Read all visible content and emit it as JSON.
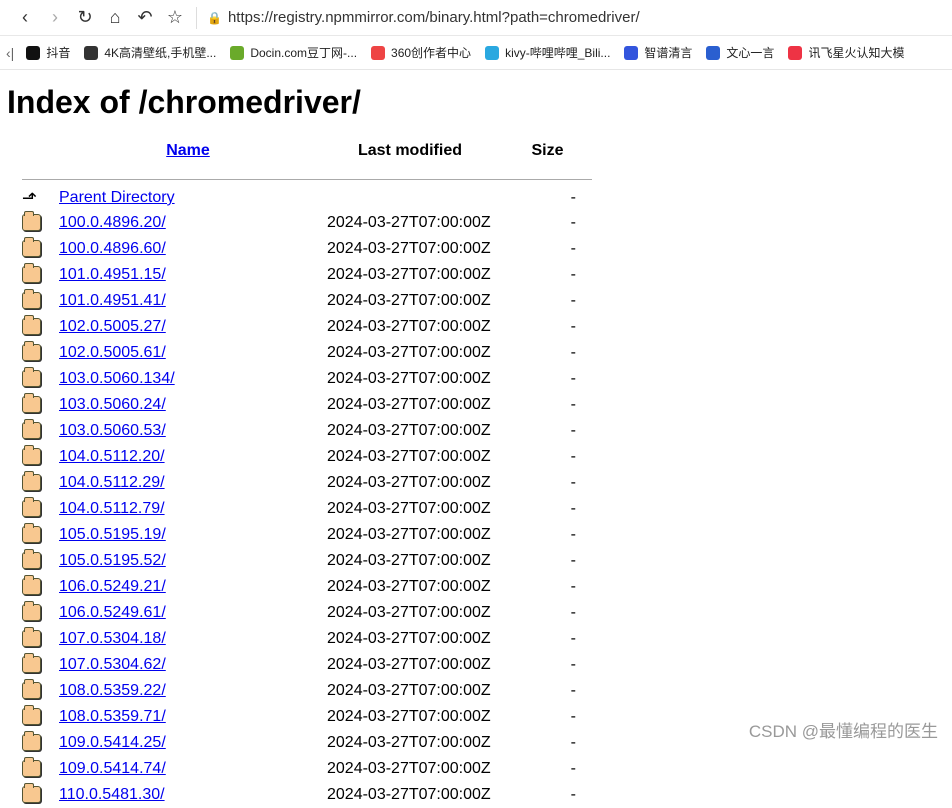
{
  "browser": {
    "url": "https://registry.npmmirror.com/binary.html?path=chromedriver/",
    "bookmarks": [
      {
        "label": "抖音",
        "color": "#111"
      },
      {
        "label": "4K高清壁纸,手机壁...",
        "color": "#333"
      },
      {
        "label": "Docin.com豆丁网-...",
        "color": "#6aaa2a"
      },
      {
        "label": "360创作者中心",
        "color": "#e44"
      },
      {
        "label": "kivy-哔哩哔哩_Bili...",
        "color": "#2aa8e0"
      },
      {
        "label": "智谱清言",
        "color": "#3355dd"
      },
      {
        "label": "文心一言",
        "color": "#2a5fd0"
      },
      {
        "label": "讯飞星火认知大模",
        "color": "#e34"
      }
    ]
  },
  "page": {
    "title": "Index of /chromedriver/",
    "headers": {
      "name": "Name",
      "modified": "Last modified",
      "size": "Size"
    },
    "parent": {
      "name": "Parent Directory",
      "size": "-"
    },
    "rows": [
      [
        "100.0.4896.20/",
        "2024-03-27T07:00:00Z",
        "-"
      ],
      [
        "100.0.4896.60/",
        "2024-03-27T07:00:00Z",
        "-"
      ],
      [
        "101.0.4951.15/",
        "2024-03-27T07:00:00Z",
        "-"
      ],
      [
        "101.0.4951.41/",
        "2024-03-27T07:00:00Z",
        "-"
      ],
      [
        "102.0.5005.27/",
        "2024-03-27T07:00:00Z",
        "-"
      ],
      [
        "102.0.5005.61/",
        "2024-03-27T07:00:00Z",
        "-"
      ],
      [
        "103.0.5060.134/",
        "2024-03-27T07:00:00Z",
        "-"
      ],
      [
        "103.0.5060.24/",
        "2024-03-27T07:00:00Z",
        "-"
      ],
      [
        "103.0.5060.53/",
        "2024-03-27T07:00:00Z",
        "-"
      ],
      [
        "104.0.5112.20/",
        "2024-03-27T07:00:00Z",
        "-"
      ],
      [
        "104.0.5112.29/",
        "2024-03-27T07:00:00Z",
        "-"
      ],
      [
        "104.0.5112.79/",
        "2024-03-27T07:00:00Z",
        "-"
      ],
      [
        "105.0.5195.19/",
        "2024-03-27T07:00:00Z",
        "-"
      ],
      [
        "105.0.5195.52/",
        "2024-03-27T07:00:00Z",
        "-"
      ],
      [
        "106.0.5249.21/",
        "2024-03-27T07:00:00Z",
        "-"
      ],
      [
        "106.0.5249.61/",
        "2024-03-27T07:00:00Z",
        "-"
      ],
      [
        "107.0.5304.18/",
        "2024-03-27T07:00:00Z",
        "-"
      ],
      [
        "107.0.5304.62/",
        "2024-03-27T07:00:00Z",
        "-"
      ],
      [
        "108.0.5359.22/",
        "2024-03-27T07:00:00Z",
        "-"
      ],
      [
        "108.0.5359.71/",
        "2024-03-27T07:00:00Z",
        "-"
      ],
      [
        "109.0.5414.25/",
        "2024-03-27T07:00:00Z",
        "-"
      ],
      [
        "109.0.5414.74/",
        "2024-03-27T07:00:00Z",
        "-"
      ],
      [
        "110.0.5481.30/",
        "2024-03-27T07:00:00Z",
        "-"
      ]
    ]
  },
  "watermark": "CSDN @最懂编程的医生"
}
